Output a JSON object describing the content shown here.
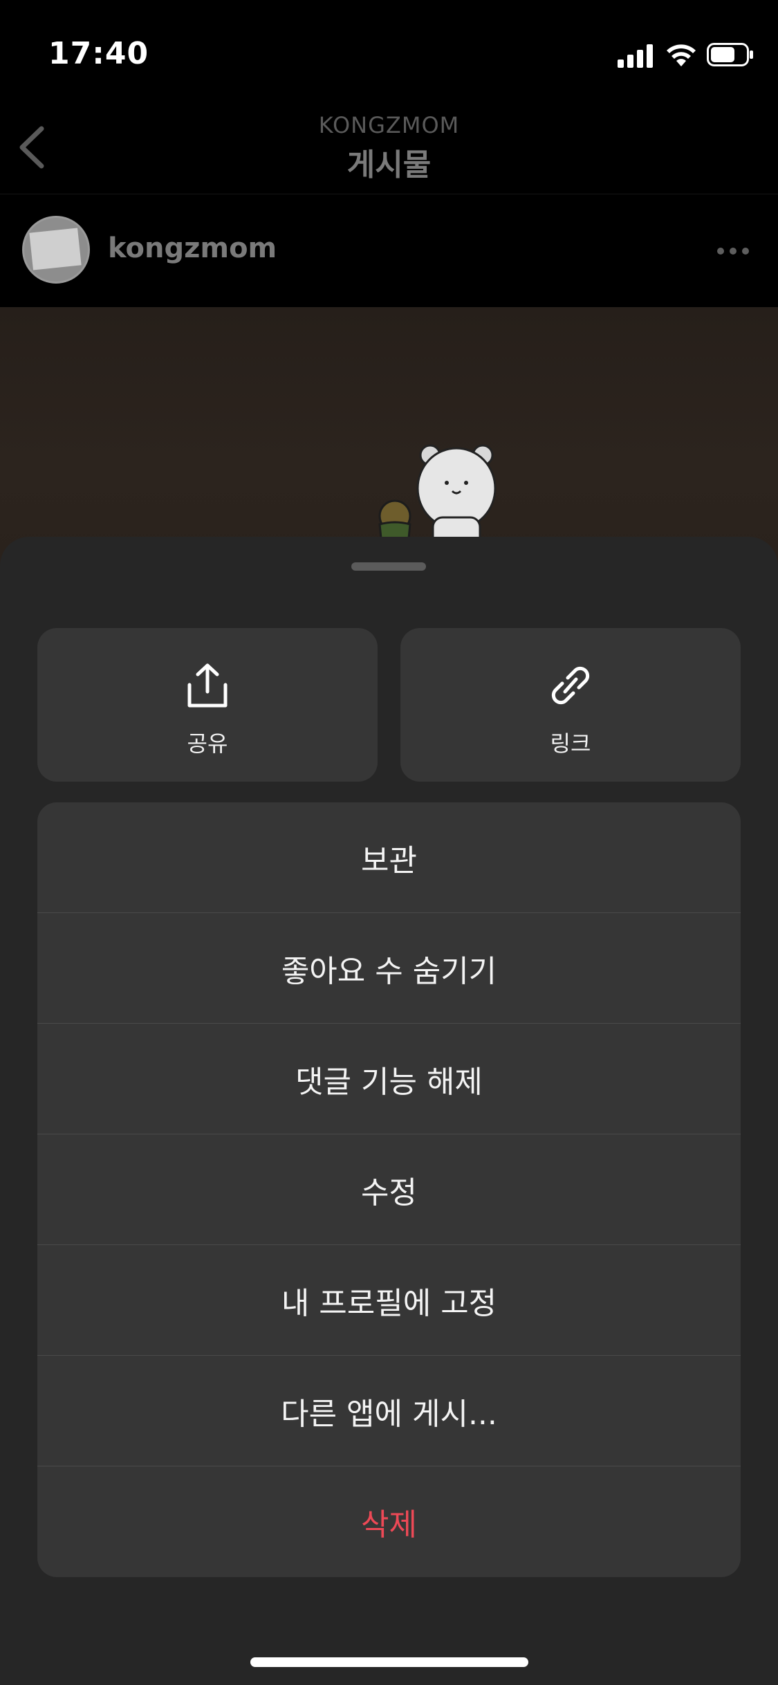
{
  "status": {
    "time": "17:40"
  },
  "header": {
    "username": "KONGZMOM",
    "title": "게시물"
  },
  "post": {
    "username": "kongzmom"
  },
  "sheet": {
    "actions": [
      {
        "label": "공유",
        "icon": "share-icon"
      },
      {
        "label": "링크",
        "icon": "link-icon"
      }
    ],
    "menu": [
      {
        "label": "보관"
      },
      {
        "label": "좋아요 수 숨기기"
      },
      {
        "label": "댓글 기능 해제"
      },
      {
        "label": "수정"
      },
      {
        "label": "내 프로필에 고정"
      },
      {
        "label": "다른 앱에 게시..."
      },
      {
        "label": "삭제"
      }
    ]
  },
  "colors": {
    "danger": "#ed4956",
    "sheet": "#262626",
    "card": "#363636"
  }
}
